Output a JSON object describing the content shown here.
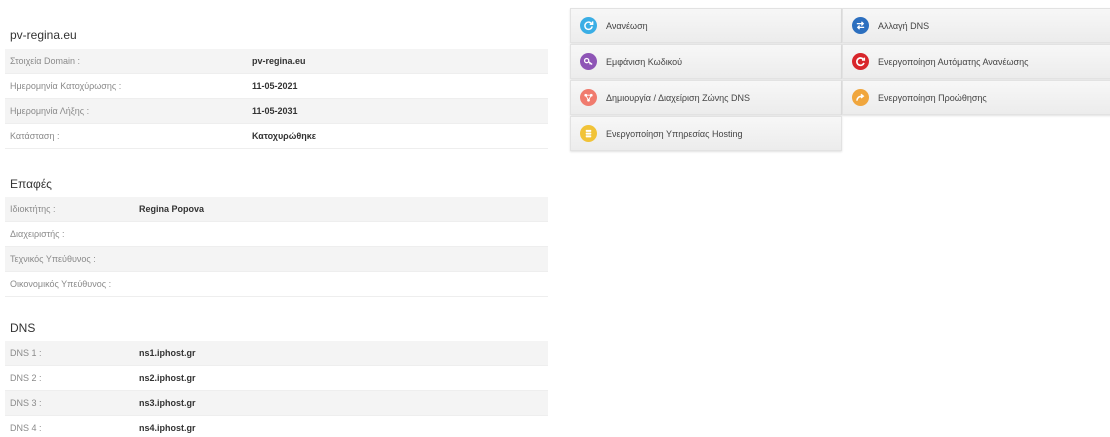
{
  "domain_section": {
    "title": "pv-regina.eu",
    "rows": [
      {
        "label": "Στοιχεία Domain :",
        "value": "pv-regina.eu"
      },
      {
        "label": "Ημερομηνία Κατοχύρωσης :",
        "value": "11-05-2021"
      },
      {
        "label": "Ημερομηνία Λήξης :",
        "value": "11-05-2031"
      },
      {
        "label": "Κατάσταση :",
        "value": "Κατοχυρώθηκε"
      }
    ]
  },
  "contacts_section": {
    "title": "Επαφές",
    "rows": [
      {
        "label": "Ιδιοκτήτης :",
        "value": "Regina Popova"
      },
      {
        "label": "Διαχειριστής :",
        "value": ""
      },
      {
        "label": "Τεχνικός Υπεύθυνος :",
        "value": ""
      },
      {
        "label": "Οικονομικός Υπεύθυνος :",
        "value": ""
      }
    ]
  },
  "dns_section": {
    "title": "DNS",
    "rows": [
      {
        "label": "DNS 1 :",
        "value": "ns1.iphost.gr"
      },
      {
        "label": "DNS 2 :",
        "value": "ns2.iphost.gr"
      },
      {
        "label": "DNS 3 :",
        "value": "ns3.iphost.gr"
      },
      {
        "label": "DNS 4 :",
        "value": "ns4.iphost.gr"
      }
    ]
  },
  "actions": [
    {
      "label": "Ανανέωση",
      "icon": "refresh-icon",
      "color": "#3aaee5"
    },
    {
      "label": "Αλλαγή DNS",
      "icon": "swap-arrows-icon",
      "color": "#2c6fbf"
    },
    {
      "label": "Εμφάνιση Κωδικού",
      "icon": "key-icon",
      "color": "#8e55b6"
    },
    {
      "label": "Ενεργοποίηση Αυτόματης Ανανέωσης",
      "icon": "auto-renew-icon",
      "color": "#d8262b"
    },
    {
      "label": "Δημιουργία / Διαχείριση Ζώνης DNS",
      "icon": "network-zone-icon",
      "color": "#f07b6e"
    },
    {
      "label": "Ενεργοποίηση Προώθησης",
      "icon": "forward-arrow-icon",
      "color": "#f0a63d"
    },
    {
      "label": "Ενεργοποίηση Υπηρεσίας Hosting",
      "icon": "database-icon",
      "color": "#f1c338"
    }
  ]
}
